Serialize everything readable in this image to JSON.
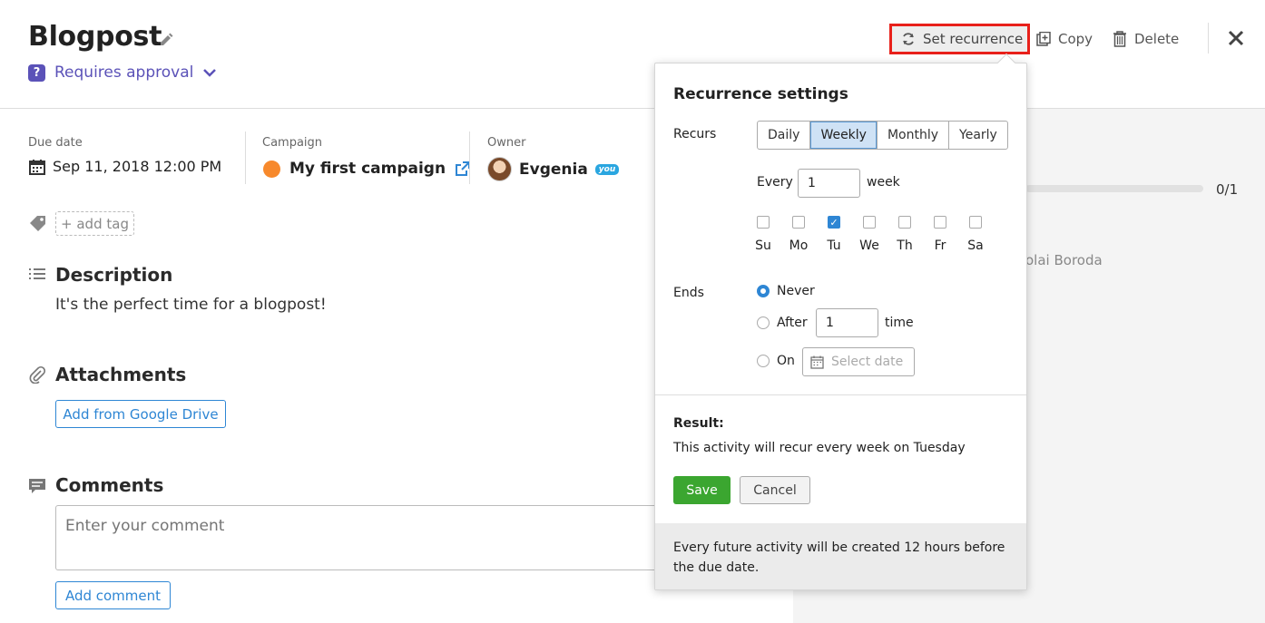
{
  "header": {
    "title": "Blogpost",
    "approval_label": "Requires approval",
    "set_recurrence_label": "Set recurrence",
    "copy_label": "Copy",
    "delete_label": "Delete"
  },
  "meta": {
    "due_date_label": "Due date",
    "due_date_value": "Sep 11, 2018 12:00 PM",
    "campaign_label": "Campaign",
    "campaign_value": "My first campaign",
    "owner_label": "Owner",
    "owner_value": "Evgenia",
    "owner_badge": "you"
  },
  "tags": {
    "add_tag_label": "+ add tag"
  },
  "description": {
    "title": "Description",
    "text": "It's the perfect time for a blogpost!"
  },
  "attachments": {
    "title": "Attachments",
    "button_label": "Add from Google Drive"
  },
  "comments": {
    "title": "Comments",
    "placeholder": "Enter your comment",
    "button_label": "Add comment"
  },
  "right_pane": {
    "progress_text": "0/1",
    "progress_fraction": 0,
    "assignee_fragment": "olai Boroda"
  },
  "recurrence": {
    "title": "Recurrence settings",
    "recurs_label": "Recurs",
    "options": [
      "Daily",
      "Weekly",
      "Monthly",
      "Yearly"
    ],
    "selected": "Weekly",
    "every_label": "Every",
    "every_value": "1",
    "every_unit": "week",
    "days": [
      {
        "label": "Su",
        "checked": false
      },
      {
        "label": "Mo",
        "checked": false
      },
      {
        "label": "Tu",
        "checked": true
      },
      {
        "label": "We",
        "checked": false
      },
      {
        "label": "Th",
        "checked": false
      },
      {
        "label": "Fr",
        "checked": false
      },
      {
        "label": "Sa",
        "checked": false
      }
    ],
    "ends_label": "Ends",
    "never_label": "Never",
    "after_label": "After",
    "after_value": "1",
    "after_unit": "time",
    "on_label": "On",
    "date_placeholder": "Select date",
    "result_label": "Result:",
    "result_text": "This activity will recur every week on Tuesday",
    "save_label": "Save",
    "cancel_label": "Cancel",
    "footer_text": "Every future activity will be created 12 hours before the due date."
  }
}
